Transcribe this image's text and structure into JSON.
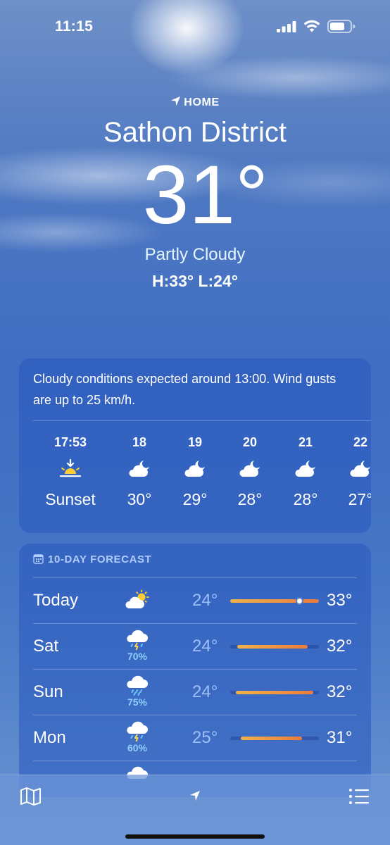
{
  "status_bar": {
    "time": "11:15"
  },
  "header": {
    "location_label": "HOME",
    "city": "Sathon District",
    "temperature": "31°",
    "condition": "Partly Cloudy",
    "high_low": "H:33°  L:24°"
  },
  "hourly": {
    "summary": "Cloudy conditions expected around 13:00. Wind gusts are up to 25 km/h.",
    "items": [
      {
        "time": "17:53",
        "icon": "sunset-icon",
        "temp": "Sunset"
      },
      {
        "time": "18",
        "icon": "cloud-moon-icon",
        "temp": "30°"
      },
      {
        "time": "19",
        "icon": "cloud-moon-icon",
        "temp": "29°"
      },
      {
        "time": "20",
        "icon": "cloud-moon-icon",
        "temp": "28°"
      },
      {
        "time": "21",
        "icon": "cloud-moon-icon",
        "temp": "28°"
      },
      {
        "time": "22",
        "icon": "cloud-moon-icon",
        "temp": "27°"
      }
    ]
  },
  "forecast": {
    "title": "10-DAY FORECAST",
    "days": [
      {
        "day": "Today",
        "icon": "cloud-sun-icon",
        "precip": "",
        "low": "24°",
        "high": "33°",
        "range_start": 0.0,
        "range_end": 1.0,
        "current": 0.78
      },
      {
        "day": "Sat",
        "icon": "cloud-rain-lightning-icon",
        "precip": "70%",
        "low": "24°",
        "high": "32°",
        "range_start": 0.08,
        "range_end": 0.87
      },
      {
        "day": "Sun",
        "icon": "cloud-rain-icon",
        "precip": "75%",
        "low": "24°",
        "high": "32°",
        "range_start": 0.06,
        "range_end": 0.94
      },
      {
        "day": "Mon",
        "icon": "cloud-rain-lightning-icon",
        "precip": "60%",
        "low": "25°",
        "high": "31°",
        "range_start": 0.12,
        "range_end": 0.81
      }
    ]
  },
  "toolbar": {
    "left_icon": "map-icon",
    "center_icon": "location-arrow-icon",
    "right_icon": "list-icon"
  },
  "colors": {
    "bar_start": "#f1b24b",
    "bar_end": "#ec7b3c",
    "precip_text": "#8fd0ff"
  }
}
